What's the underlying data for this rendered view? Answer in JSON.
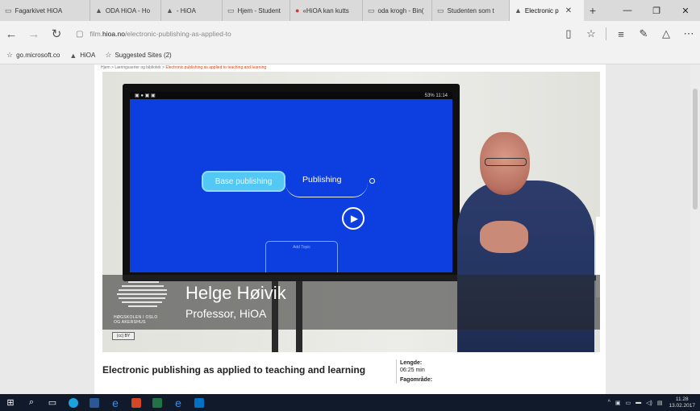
{
  "tabs": [
    {
      "label": "Fagarkivet HiOA",
      "icon": "page-icon",
      "active": false
    },
    {
      "label": "ODA HiOA - Ho",
      "icon": "hioa-icon",
      "active": false
    },
    {
      "label": "- HiOA",
      "icon": "hioa-icon",
      "active": false
    },
    {
      "label": "Hjem - Student",
      "icon": "page-icon",
      "active": false
    },
    {
      "label": "«HiOA kan kutts",
      "icon": "red-circle-icon",
      "active": false
    },
    {
      "label": "oda krogh - Bin(",
      "icon": "page-icon",
      "active": false
    },
    {
      "label": "Studenten som t",
      "icon": "page-icon",
      "active": false
    },
    {
      "label": "Electronic p",
      "icon": "hioa-icon",
      "active": true
    }
  ],
  "address": {
    "prefix": "film.",
    "domain": "hioa.no",
    "path": "/electronic-publishing-as-applied-to"
  },
  "favorites": [
    {
      "label": "go.microsoft.co",
      "icon": "star-icon"
    },
    {
      "label": "HiOA",
      "icon": "hioa-icon"
    },
    {
      "label": "Suggested Sites (2)",
      "icon": "star-icon"
    }
  ],
  "breadcrumb": {
    "path": "Hjem > Læringsserier og bibliotek > ",
    "current": "Electronic publishing as applied to teaching and learning"
  },
  "video": {
    "status_time": "11:14",
    "status_battery": "53%",
    "node_primary": "Base publishing",
    "node_secondary": "Publishing",
    "add_topic": "Add Topic",
    "speaker_name": "Helge Høivik",
    "speaker_title": "Professor, HiOA",
    "logo_line1": "HØGSKOLEN I OSLO",
    "logo_line2": "OG AKERSHUS",
    "cc_badge": "(cc) BY"
  },
  "video_title": "Electronic publishing as applied to teaching and learning",
  "meta": {
    "length_label": "Lengde:",
    "length_value": "06:25 min",
    "subject_label": "Fagområde:"
  },
  "taskbar": {
    "time": "11.28",
    "date": "13.02.2017"
  },
  "colors": {
    "screen_blue": "#0d3ee0",
    "node_cyan": "#53c8f5",
    "breadcrumb_accent": "#d7461a",
    "taskbar_bg": "#101a2a"
  }
}
